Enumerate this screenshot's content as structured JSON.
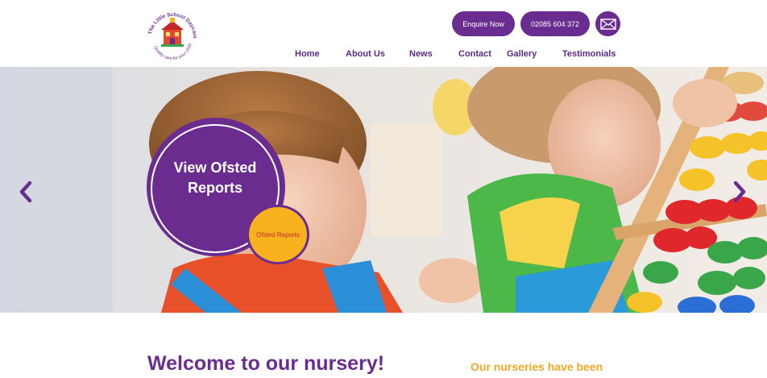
{
  "header": {
    "logo": {
      "arc_text_top": "The Little School Daycare",
      "arc_text_bottom": "Quality care for your child",
      "icon": "schoolhouse-icon"
    },
    "enquire_label": "Enquire Now",
    "phone_label": "02085 604 372",
    "mail_icon": "envelope-icon"
  },
  "nav": {
    "items": [
      {
        "label": "Home"
      },
      {
        "label": "About Us"
      },
      {
        "label": "News"
      },
      {
        "label": "Contact"
      },
      {
        "label": "Gallery"
      },
      {
        "label": "Testimonials"
      }
    ]
  },
  "hero": {
    "ofsted_title": "View Ofsted Reports",
    "ofsted_badge_label": "Ofsted Reports",
    "prev_icon": "chevron-left-icon",
    "next_icon": "chevron-right-icon"
  },
  "main": {
    "welcome_heading": "Welcome to our nursery!",
    "side_text": "Our nurseries have been"
  },
  "colors": {
    "brand_purple": "#6a2c8e",
    "nav_text": "#5c2a84",
    "accent_orange": "#f9b21d",
    "side_text": "#f0a828"
  }
}
